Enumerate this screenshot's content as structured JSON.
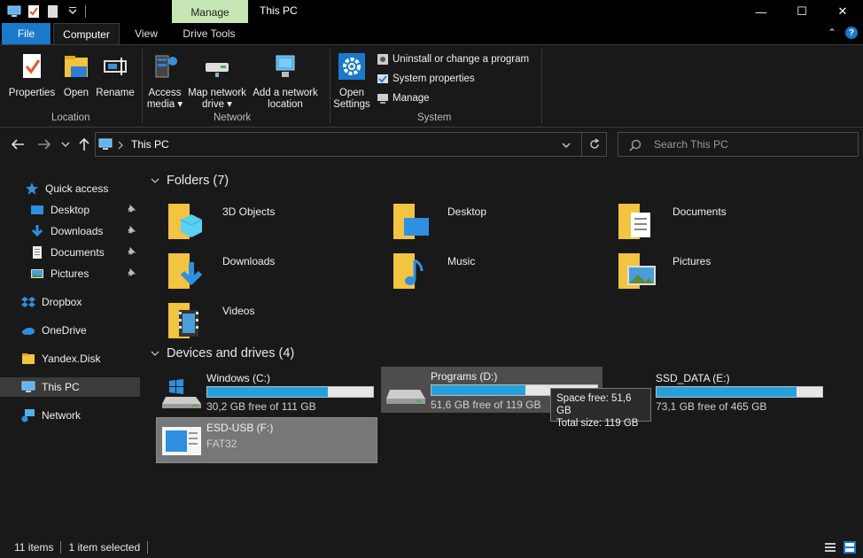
{
  "titlebar": {
    "contextual_tab": "Manage",
    "title": "This PC",
    "minimize": "—",
    "maximize": "☐",
    "close": "✕"
  },
  "ribbon_tabs": {
    "file": "File",
    "computer": "Computer",
    "view": "View",
    "drive_tools": "Drive Tools",
    "collapse": "⌃",
    "help": "?"
  },
  "ribbon": {
    "location": {
      "label": "Location",
      "properties": "Properties",
      "open": "Open",
      "rename": "Rename"
    },
    "network": {
      "label": "Network",
      "access_media_1": "Access",
      "access_media_2": "media ▾",
      "map_drive_1": "Map network",
      "map_drive_2": "drive ▾",
      "add_location_1": "Add a network",
      "add_location_2": "location"
    },
    "system": {
      "label": "System",
      "open_settings_1": "Open",
      "open_settings_2": "Settings",
      "uninstall": "Uninstall or change a program",
      "system_properties": "System properties",
      "manage": "Manage"
    }
  },
  "address": {
    "path": "This PC",
    "search_placeholder": "Search This PC"
  },
  "sidebar": {
    "items": [
      {
        "label": "Quick access"
      },
      {
        "label": "Desktop"
      },
      {
        "label": "Downloads"
      },
      {
        "label": "Documents"
      },
      {
        "label": "Pictures"
      },
      {
        "label": "Dropbox"
      },
      {
        "label": "OneDrive"
      },
      {
        "label": "Yandex.Disk"
      },
      {
        "label": "This PC"
      },
      {
        "label": "Network"
      }
    ]
  },
  "folders": {
    "header": "Folders (7)",
    "items": [
      {
        "label": "3D Objects"
      },
      {
        "label": "Desktop"
      },
      {
        "label": "Documents"
      },
      {
        "label": "Downloads"
      },
      {
        "label": "Music"
      },
      {
        "label": "Pictures"
      },
      {
        "label": "Videos"
      }
    ]
  },
  "drives": {
    "header": "Devices and drives (4)",
    "items": [
      {
        "name": "Windows (C:)",
        "free": "30,2 GB free of 111 GB",
        "used_fraction": 0.728
      },
      {
        "name": "Programs (D:)",
        "free": "51,6 GB free of 119 GB",
        "used_fraction": 0.566
      },
      {
        "name": "SSD_DATA (E:)",
        "free": "73,1 GB free of 465 GB",
        "used_fraction": 0.843
      },
      {
        "name": "ESD-USB (F:)",
        "free": "FAT32"
      }
    ]
  },
  "tooltip": {
    "line1": "Space free: 51,6 GB",
    "line2": "Total size: 119 GB"
  },
  "status": {
    "items": "11 items",
    "selected": "1 item selected"
  },
  "colors": {
    "accent": "#1979ca",
    "manage_tab": "#c6e7b4",
    "drive_bar": "#26a0da"
  }
}
